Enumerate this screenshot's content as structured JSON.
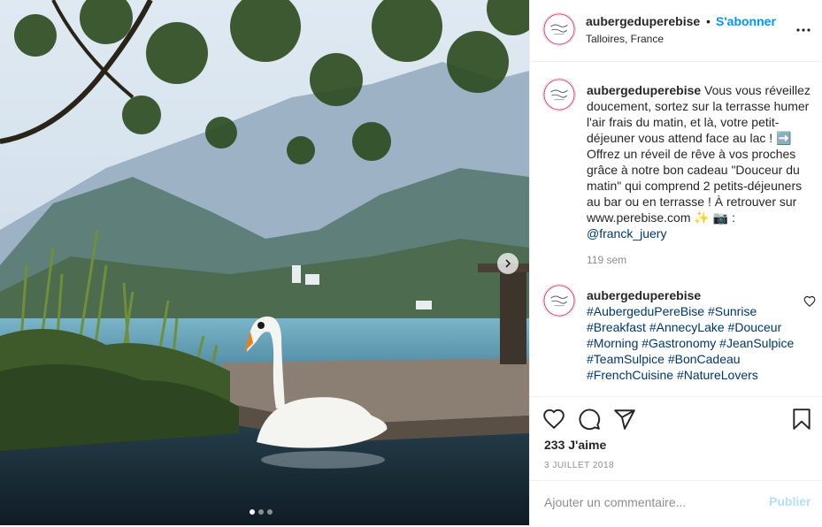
{
  "post": {
    "username": "aubergeduperebise",
    "separator": "•",
    "follow_label": "S'abonner",
    "location": "Talloires, France",
    "more_icon": "more-horizontal-icon",
    "avatar_text": "Auberge du Père Bise"
  },
  "caption": {
    "username": "aubergeduperebise",
    "text": "Vous vous réveillez doucement, sortez sur la terrasse humer l'air frais du matin, et là, votre petit-déjeuner vous attend face au lac ! ➡️ Offrez un réveil de rêve à vos proches grâce à notre bon cadeau \"Douceur du matin\" qui comprend 2 petits-déjeuners au bar ou en terrasse ! À retrouver sur www.perebise.com ✨ 📷 : ",
    "mention": "@franck_juery",
    "time": "119 sem"
  },
  "comment": {
    "username": "aubergeduperebise",
    "hashtags": "#AubergeduPereBise #Sunrise #Breakfast #AnnecyLake #Douceur #Morning #Gastronomy #JeanSulpice #TeamSulpice #BonCadeau #FrenchCuisine #NatureLovers"
  },
  "actions": {
    "icons": [
      "heart-icon",
      "comment-icon",
      "share-icon",
      "bookmark-icon"
    ],
    "likes": "233 J'aime",
    "date": "3 JUILLET 2018"
  },
  "add_comment": {
    "placeholder": "Ajouter un commentaire...",
    "publish_label": "Publier"
  },
  "carousel": {
    "slide_count": 3,
    "active_index": 0
  },
  "colors": {
    "accent": "#0095f6",
    "link": "#00376b",
    "publish_disabled": "#b2dffc"
  }
}
